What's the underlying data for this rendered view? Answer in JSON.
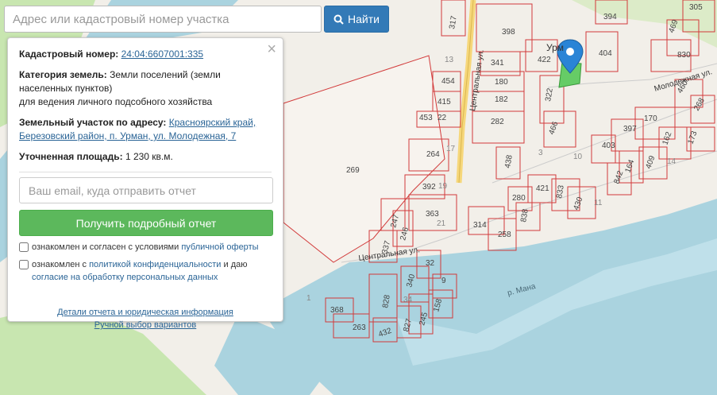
{
  "search": {
    "placeholder": "Адрес или кадастровый номер участка",
    "button_label": "Найти"
  },
  "panel": {
    "cadastral_label": "Кадастровый номер:",
    "cadastral_value": "24:04:6607001:335",
    "category_label": "Категория земель:",
    "category_value": "Земли поселений (земли населенных пунктов)",
    "category_use": "для ведения личного подсобного хозяйства",
    "address_label": "Земельный участок по адресу:",
    "address_value": "Красноярский край, Березовский район, п. Урман, ул. Молодежная, 7",
    "area_label": "Уточненная площадь:",
    "area_value": "1 230 кв.м.",
    "email_placeholder": "Ваш email, куда отправить отчет",
    "report_button": "Получить подробный отчет",
    "agree1_text": "ознакомлен и согласен с условиями",
    "agree1_link": "публичной оферты",
    "agree2_text": "ознакомлен с",
    "agree2_link": "политикой конфиденциальности",
    "agree2_mid": "и даю",
    "agree2_link2": "согласие на обработку персональных данных",
    "details_link": "Детали отчета и юридическая информация",
    "manual_link": "Ручной выбор вариантов"
  },
  "map": {
    "streets": [
      "Центральная ул.",
      "Молодежная ул.",
      "Центральная ул."
    ],
    "river": "р. Мана",
    "settlement": "Урм",
    "parcels": [
      "317",
      "398",
      "341",
      "422",
      "404",
      "394",
      "305",
      "469",
      "830",
      "454",
      "180",
      "415",
      "182",
      "322",
      "460",
      "268",
      "453",
      "22",
      "282",
      "466",
      "397",
      "170",
      "403",
      "162",
      "173",
      "264",
      "438",
      "421",
      "280",
      "833",
      "842",
      "164",
      "409",
      "269",
      "392",
      "838",
      "430",
      "363",
      "247",
      "246",
      "314",
      "258",
      "337",
      "32",
      "340",
      "9",
      "158",
      "368",
      "828",
      "263",
      "432",
      "827",
      "245",
      "13",
      "17",
      "19",
      "21",
      "3",
      "10",
      "14",
      "1",
      "34",
      "11"
    ],
    "colors": {
      "parcel_stroke": "#d23a3a",
      "water": "#aad3df",
      "forest": "#c8e6b0",
      "road": "#f6d77a",
      "selected": "#66cc66",
      "marker": "#2a84d6"
    }
  }
}
